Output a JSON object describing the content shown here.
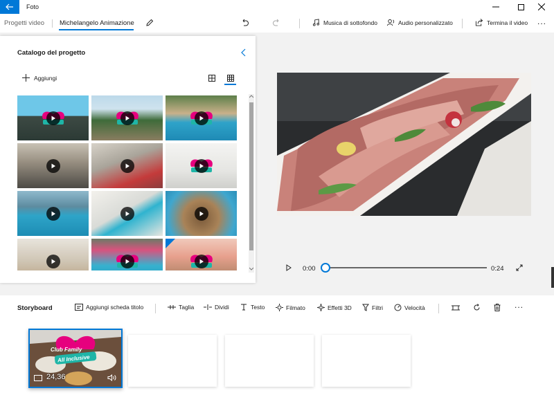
{
  "app": {
    "title": "Foto"
  },
  "toolbar": {
    "crumb_parent": "Progetti video",
    "crumb_current": "Michelangelo Animazione",
    "music_label": "Musica di sottofondo",
    "audio_label": "Audio personalizzato",
    "finish_label": "Termina il video",
    "more_label": "..."
  },
  "catalog": {
    "title": "Catalogo del progetto",
    "add_label": "Aggiungi"
  },
  "player": {
    "current_time": "0:00",
    "total_time": "0:24",
    "progress": 0
  },
  "storyboard": {
    "title": "Storyboard",
    "tools": {
      "title_card": "Aggiungi scheda titolo",
      "trim": "Taglia",
      "split": "Dividi",
      "text": "Testo",
      "motion": "Filmato",
      "effects_3d": "Effetti 3D",
      "filters": "Filtri",
      "speed": "Velocità"
    },
    "clip": {
      "duration": "24,36",
      "badge_line1": "Club Family",
      "badge_line2": "All Inclusive"
    }
  },
  "colors": {
    "accent": "#0078d7",
    "badge_pink": "#e6007e",
    "badge_teal": "#1fb5a7"
  }
}
